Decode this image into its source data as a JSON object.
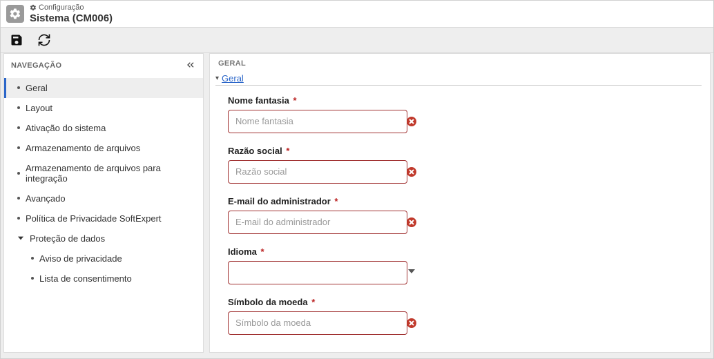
{
  "header": {
    "breadcrumb": "Configuração",
    "title": "Sistema (CM006)"
  },
  "toolbar": {
    "save_label": "Salvar",
    "refresh_label": "Atualizar"
  },
  "sidebar": {
    "title": "NAVEGAÇÃO",
    "items": [
      {
        "label": "Geral",
        "active": true,
        "type": "leaf"
      },
      {
        "label": "Layout",
        "type": "leaf"
      },
      {
        "label": "Ativação do sistema",
        "type": "leaf"
      },
      {
        "label": "Armazenamento de arquivos",
        "type": "leaf"
      },
      {
        "label": "Armazenamento de arquivos para integração",
        "type": "leaf"
      },
      {
        "label": "Avançado",
        "type": "leaf"
      },
      {
        "label": "Política de Privacidade SoftExpert",
        "type": "leaf"
      },
      {
        "label": "Proteção de dados",
        "type": "branch",
        "expanded": true
      },
      {
        "label": "Aviso de privacidade",
        "type": "sub"
      },
      {
        "label": "Lista de consentimento",
        "type": "sub"
      }
    ]
  },
  "main": {
    "panel_title": "GERAL",
    "section_title": "Geral",
    "fields": [
      {
        "label": "Nome fantasia",
        "placeholder": "Nome fantasia",
        "required": true,
        "error": true,
        "kind": "text"
      },
      {
        "label": "Razão social",
        "placeholder": "Razão social",
        "required": true,
        "error": true,
        "kind": "text"
      },
      {
        "label": "E-mail do administrador",
        "placeholder": "E-mail do administrador",
        "required": true,
        "error": true,
        "kind": "text"
      },
      {
        "label": "Idioma",
        "placeholder": "",
        "required": true,
        "error": false,
        "kind": "select"
      },
      {
        "label": "Símbolo da moeda",
        "placeholder": "Símbolo da moeda",
        "required": true,
        "error": true,
        "kind": "text"
      }
    ]
  }
}
